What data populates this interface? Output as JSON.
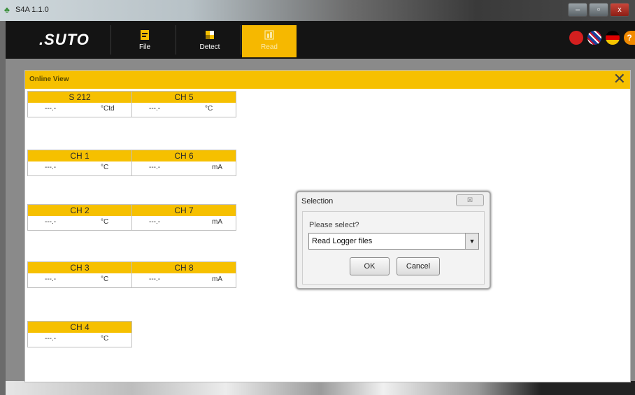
{
  "window": {
    "title": "S4A  1.1.0",
    "controls": {
      "minimize": "–",
      "maximize": "▫",
      "close": "x"
    }
  },
  "toolbar": {
    "logo": ".SUTO",
    "buttons": [
      {
        "label": "File",
        "icon": "file-icon",
        "active": false
      },
      {
        "label": "Detect",
        "icon": "detect-icon",
        "active": false
      },
      {
        "label": "Read",
        "icon": "read-icon",
        "active": true
      }
    ],
    "languages": [
      "china-flag-icon",
      "uk-flag-icon",
      "germany-flag-icon"
    ],
    "help": "?"
  },
  "panel": {
    "title": "Online View",
    "close": "✕",
    "channels": [
      {
        "name": "S 212",
        "value": "---.-",
        "unit": "°Ctd"
      },
      {
        "name": "CH 5",
        "value": "---.-",
        "unit": "°C"
      },
      {
        "name": "CH 1",
        "value": "---.-",
        "unit": "°C"
      },
      {
        "name": "CH 6",
        "value": "---.-",
        "unit": "mA"
      },
      {
        "name": "CH 2",
        "value": "---.-",
        "unit": "°C"
      },
      {
        "name": "CH 7",
        "value": "---.-",
        "unit": "mA"
      },
      {
        "name": "CH 3",
        "value": "---.-",
        "unit": "°C"
      },
      {
        "name": "CH 8",
        "value": "---.-",
        "unit": "mA"
      },
      {
        "name": "CH 4",
        "value": "---.-",
        "unit": "°C"
      }
    ]
  },
  "dialog": {
    "title": "Selection",
    "close": "☒",
    "prompt": "Please select?",
    "selected": "Read Logger files",
    "ok": "OK",
    "cancel": "Cancel"
  },
  "colors": {
    "accent": "#f6c000",
    "toolbar": "#141414"
  }
}
